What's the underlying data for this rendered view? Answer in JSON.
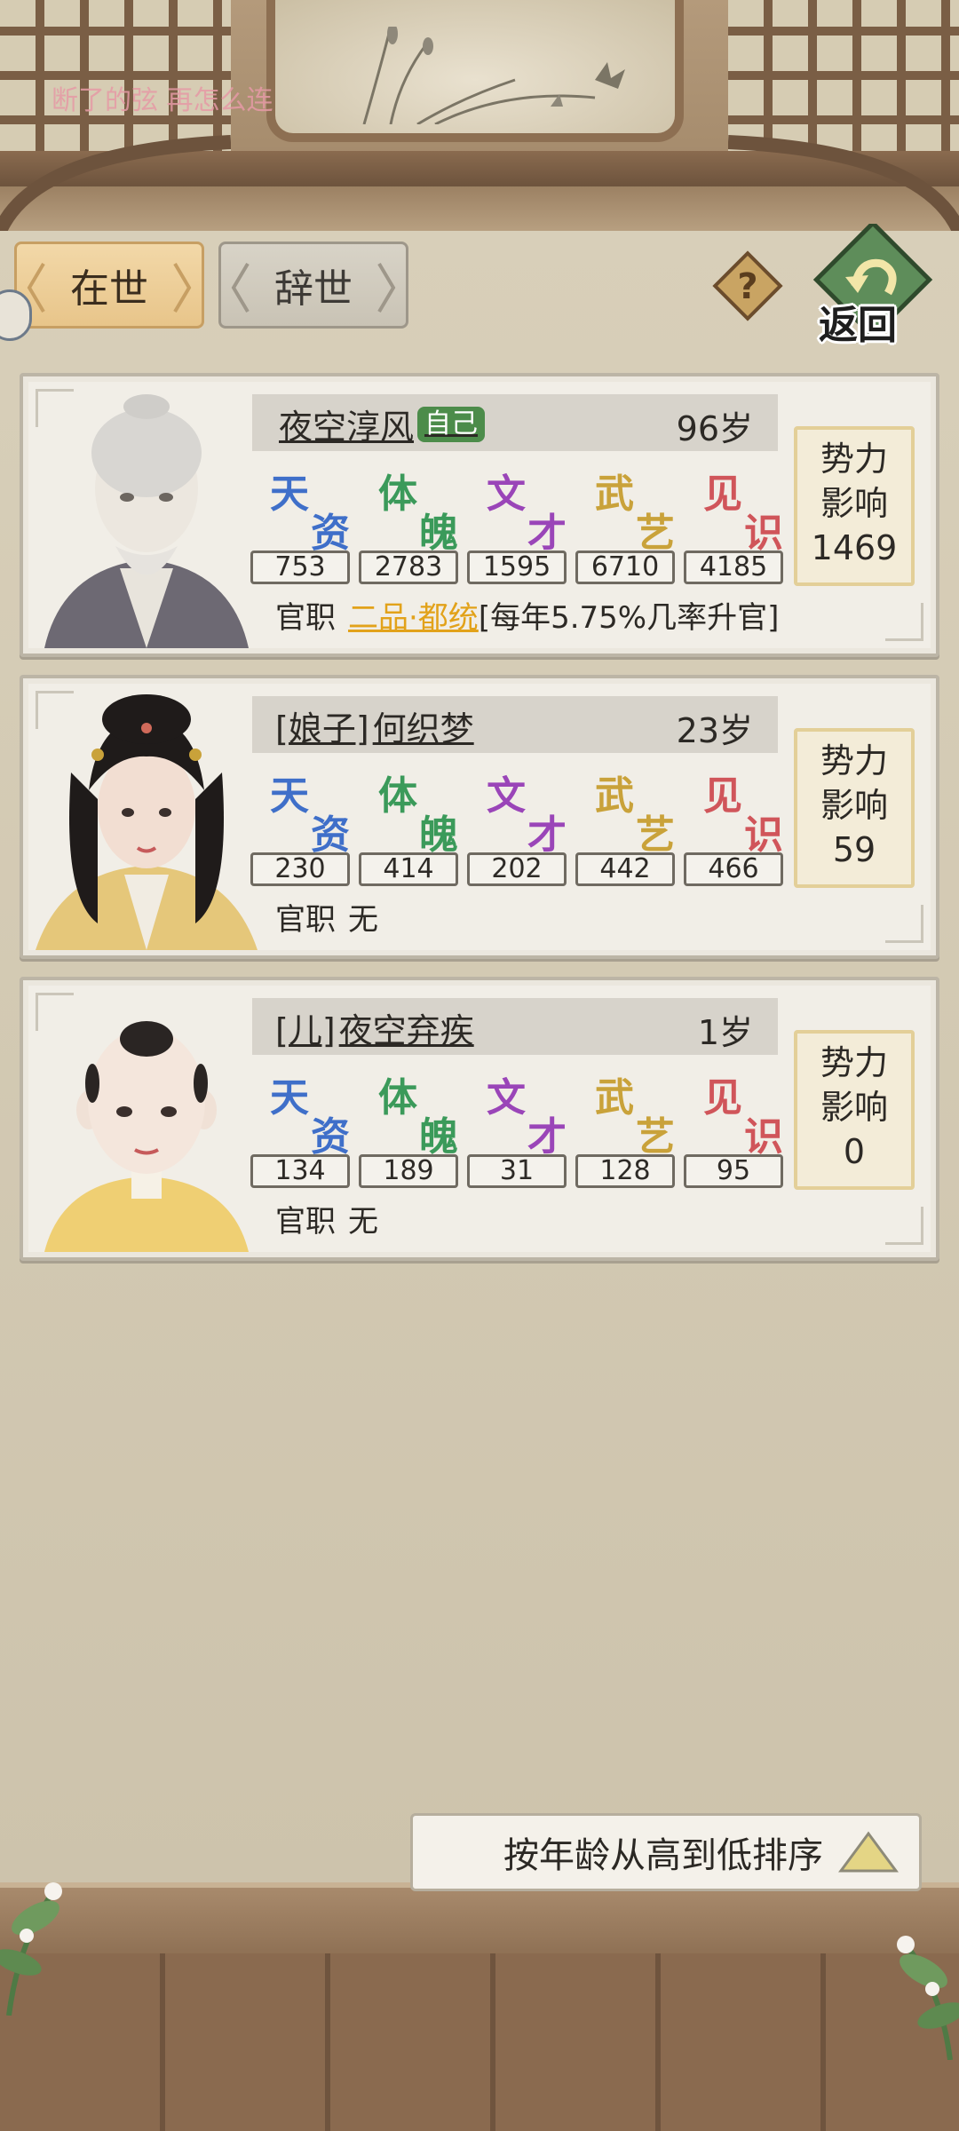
{
  "watermark": "断了的弦 再怎么连",
  "tabs": [
    {
      "label": "在世",
      "active": true
    },
    {
      "label": "辞世",
      "active": false
    }
  ],
  "back_label": "返回",
  "stat_labels": [
    {
      "a": "天",
      "b": "资",
      "color": "#3f6fc9"
    },
    {
      "a": "体",
      "b": "魄",
      "color": "#3b9a5a"
    },
    {
      "a": "文",
      "b": "才",
      "color": "#9a45b8"
    },
    {
      "a": "武",
      "b": "艺",
      "color": "#c9a23a"
    },
    {
      "a": "见",
      "b": "识",
      "color": "#d0555a"
    }
  ],
  "power_label_1": "势力",
  "power_label_2": "影响",
  "office_label": "官职",
  "people": [
    {
      "name": "夜空淳风",
      "prefix": "",
      "self_badge": "自己",
      "age": "96岁",
      "stats": [
        "753",
        "2783",
        "1595",
        "6710",
        "4185"
      ],
      "office_rank": "二品·都统",
      "office_note": "[每年5.75%几率升官]",
      "power": "1469"
    },
    {
      "name": "何织梦",
      "prefix": "[娘子]",
      "self_badge": "",
      "age": "23岁",
      "stats": [
        "230",
        "414",
        "202",
        "442",
        "466"
      ],
      "office_rank": "",
      "office_note": "无",
      "power": "59"
    },
    {
      "name": "夜空弃疾",
      "prefix": "[儿]",
      "self_badge": "",
      "age": "1岁",
      "stats": [
        "134",
        "189",
        "31",
        "128",
        "95"
      ],
      "office_rank": "",
      "office_note": "无",
      "power": "0"
    }
  ],
  "sort_label": "按年龄从高到低排序"
}
